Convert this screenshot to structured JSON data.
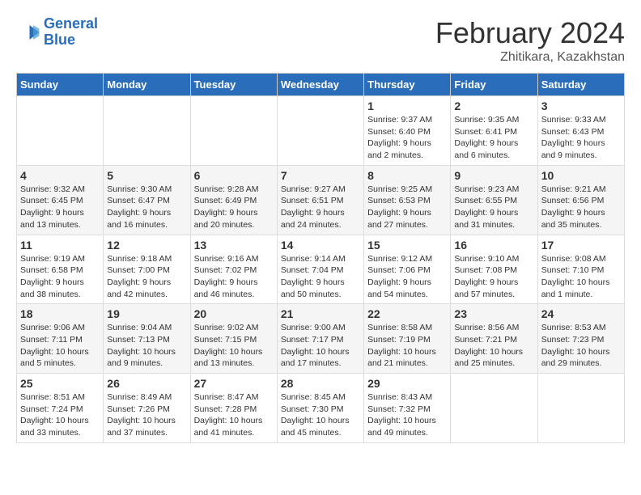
{
  "header": {
    "logo_line1": "General",
    "logo_line2": "Blue",
    "month": "February 2024",
    "location": "Zhitikara, Kazakhstan"
  },
  "days_of_week": [
    "Sunday",
    "Monday",
    "Tuesday",
    "Wednesday",
    "Thursday",
    "Friday",
    "Saturday"
  ],
  "weeks": [
    [
      {
        "day": "",
        "info": ""
      },
      {
        "day": "",
        "info": ""
      },
      {
        "day": "",
        "info": ""
      },
      {
        "day": "",
        "info": ""
      },
      {
        "day": "1",
        "info": "Sunrise: 9:37 AM\nSunset: 6:40 PM\nDaylight: 9 hours\nand 2 minutes."
      },
      {
        "day": "2",
        "info": "Sunrise: 9:35 AM\nSunset: 6:41 PM\nDaylight: 9 hours\nand 6 minutes."
      },
      {
        "day": "3",
        "info": "Sunrise: 9:33 AM\nSunset: 6:43 PM\nDaylight: 9 hours\nand 9 minutes."
      }
    ],
    [
      {
        "day": "4",
        "info": "Sunrise: 9:32 AM\nSunset: 6:45 PM\nDaylight: 9 hours\nand 13 minutes."
      },
      {
        "day": "5",
        "info": "Sunrise: 9:30 AM\nSunset: 6:47 PM\nDaylight: 9 hours\nand 16 minutes."
      },
      {
        "day": "6",
        "info": "Sunrise: 9:28 AM\nSunset: 6:49 PM\nDaylight: 9 hours\nand 20 minutes."
      },
      {
        "day": "7",
        "info": "Sunrise: 9:27 AM\nSunset: 6:51 PM\nDaylight: 9 hours\nand 24 minutes."
      },
      {
        "day": "8",
        "info": "Sunrise: 9:25 AM\nSunset: 6:53 PM\nDaylight: 9 hours\nand 27 minutes."
      },
      {
        "day": "9",
        "info": "Sunrise: 9:23 AM\nSunset: 6:55 PM\nDaylight: 9 hours\nand 31 minutes."
      },
      {
        "day": "10",
        "info": "Sunrise: 9:21 AM\nSunset: 6:56 PM\nDaylight: 9 hours\nand 35 minutes."
      }
    ],
    [
      {
        "day": "11",
        "info": "Sunrise: 9:19 AM\nSunset: 6:58 PM\nDaylight: 9 hours\nand 38 minutes."
      },
      {
        "day": "12",
        "info": "Sunrise: 9:18 AM\nSunset: 7:00 PM\nDaylight: 9 hours\nand 42 minutes."
      },
      {
        "day": "13",
        "info": "Sunrise: 9:16 AM\nSunset: 7:02 PM\nDaylight: 9 hours\nand 46 minutes."
      },
      {
        "day": "14",
        "info": "Sunrise: 9:14 AM\nSunset: 7:04 PM\nDaylight: 9 hours\nand 50 minutes."
      },
      {
        "day": "15",
        "info": "Sunrise: 9:12 AM\nSunset: 7:06 PM\nDaylight: 9 hours\nand 54 minutes."
      },
      {
        "day": "16",
        "info": "Sunrise: 9:10 AM\nSunset: 7:08 PM\nDaylight: 9 hours\nand 57 minutes."
      },
      {
        "day": "17",
        "info": "Sunrise: 9:08 AM\nSunset: 7:10 PM\nDaylight: 10 hours\nand 1 minute."
      }
    ],
    [
      {
        "day": "18",
        "info": "Sunrise: 9:06 AM\nSunset: 7:11 PM\nDaylight: 10 hours\nand 5 minutes."
      },
      {
        "day": "19",
        "info": "Sunrise: 9:04 AM\nSunset: 7:13 PM\nDaylight: 10 hours\nand 9 minutes."
      },
      {
        "day": "20",
        "info": "Sunrise: 9:02 AM\nSunset: 7:15 PM\nDaylight: 10 hours\nand 13 minutes."
      },
      {
        "day": "21",
        "info": "Sunrise: 9:00 AM\nSunset: 7:17 PM\nDaylight: 10 hours\nand 17 minutes."
      },
      {
        "day": "22",
        "info": "Sunrise: 8:58 AM\nSunset: 7:19 PM\nDaylight: 10 hours\nand 21 minutes."
      },
      {
        "day": "23",
        "info": "Sunrise: 8:56 AM\nSunset: 7:21 PM\nDaylight: 10 hours\nand 25 minutes."
      },
      {
        "day": "24",
        "info": "Sunrise: 8:53 AM\nSunset: 7:23 PM\nDaylight: 10 hours\nand 29 minutes."
      }
    ],
    [
      {
        "day": "25",
        "info": "Sunrise: 8:51 AM\nSunset: 7:24 PM\nDaylight: 10 hours\nand 33 minutes."
      },
      {
        "day": "26",
        "info": "Sunrise: 8:49 AM\nSunset: 7:26 PM\nDaylight: 10 hours\nand 37 minutes."
      },
      {
        "day": "27",
        "info": "Sunrise: 8:47 AM\nSunset: 7:28 PM\nDaylight: 10 hours\nand 41 minutes."
      },
      {
        "day": "28",
        "info": "Sunrise: 8:45 AM\nSunset: 7:30 PM\nDaylight: 10 hours\nand 45 minutes."
      },
      {
        "day": "29",
        "info": "Sunrise: 8:43 AM\nSunset: 7:32 PM\nDaylight: 10 hours\nand 49 minutes."
      },
      {
        "day": "",
        "info": ""
      },
      {
        "day": "",
        "info": ""
      }
    ]
  ]
}
